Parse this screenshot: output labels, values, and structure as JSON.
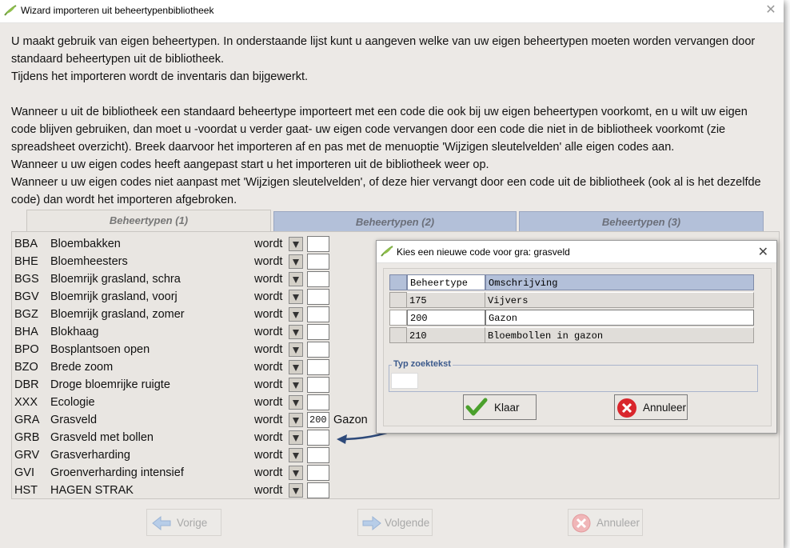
{
  "window": {
    "title": "Wizard importeren uit beheertypenbibliotheek",
    "close_glyph": "✕"
  },
  "intro": {
    "lines": [
      "U maakt gebruik van eigen beheertypen. In onderstaande lijst kunt u aangeven welke van uw eigen beheertypen moeten worden vervangen door standaard beheertypen uit de bibliotheek.",
      "Tijdens het importeren wordt de inventaris dan bijgewerkt.",
      "",
      "Wanneer u uit de bibliotheek een standaard beheertype importeert met een code die ook bij uw eigen beheertypen voorkomt, en u wilt uw eigen code blijven gebruiken, dan moet u -voordat u verder gaat- uw eigen code vervangen door een code die niet in de bibliotheek voorkomt (zie spreadsheet overzicht). Breek daarvoor het importeren af en pas met de menuoptie 'Wijzigen sleutelvelden' alle eigen codes aan.",
      "Wanneer u uw eigen codes heeft aangepast start u het importeren uit de bibliotheek weer op.",
      "Wanneer u uw eigen codes niet aanpast met 'Wijzigen sleutelvelden', of deze hier vervangt door een code uit de bibliotheek (ook al is het dezelfde code) dan wordt het importeren afgebroken."
    ]
  },
  "tabs": [
    {
      "label": "Beheertypen (1)",
      "active": true
    },
    {
      "label": "Beheertypen (2)",
      "active": false
    },
    {
      "label": "Beheertypen (3)",
      "active": false
    }
  ],
  "rows": [
    {
      "code": "BBA",
      "name": "Bloembakken",
      "wordt": "wordt",
      "value": "",
      "result": ""
    },
    {
      "code": "BHE",
      "name": "Bloemheesters",
      "wordt": "wordt",
      "value": "",
      "result": ""
    },
    {
      "code": "BGS",
      "name": "Bloemrijk grasland, schra",
      "wordt": "wordt",
      "value": "",
      "result": ""
    },
    {
      "code": "BGV",
      "name": "Bloemrijk grasland, voorj",
      "wordt": "wordt",
      "value": "",
      "result": ""
    },
    {
      "code": "BGZ",
      "name": "Bloemrijk grasland, zomer",
      "wordt": "wordt",
      "value": "",
      "result": ""
    },
    {
      "code": "BHA",
      "name": "Blokhaag",
      "wordt": "wordt",
      "value": "",
      "result": ""
    },
    {
      "code": "BPO",
      "name": "Bosplantsoen open",
      "wordt": "wordt",
      "value": "",
      "result": ""
    },
    {
      "code": "BZO",
      "name": "Brede zoom",
      "wordt": "wordt",
      "value": "",
      "result": ""
    },
    {
      "code": "DBR",
      "name": "Droge bloemrijke ruigte",
      "wordt": "wordt",
      "value": "",
      "result": ""
    },
    {
      "code": "XXX",
      "name": "Ecologie",
      "wordt": "wordt",
      "value": "",
      "result": ""
    },
    {
      "code": "GRA",
      "name": "Grasveld",
      "wordt": "wordt",
      "value": "200",
      "result": "Gazon"
    },
    {
      "code": "GRB",
      "name": "Grasveld met bollen",
      "wordt": "wordt",
      "value": "",
      "result": ""
    },
    {
      "code": "GRV",
      "name": "Grasverharding",
      "wordt": "wordt",
      "value": "",
      "result": ""
    },
    {
      "code": "GVI",
      "name": "Groenverharding intensief",
      "wordt": "wordt",
      "value": "",
      "result": ""
    },
    {
      "code": "HST",
      "name": "HAGEN STRAK",
      "wordt": "wordt",
      "value": "",
      "result": ""
    }
  ],
  "nav": {
    "prev": "Vorige",
    "next": "Volgende",
    "cancel": "Annuleer"
  },
  "dialog": {
    "title": "Kies een nieuwe code voor gra: grasveld",
    "close_glyph": "✕",
    "columns": [
      "Beheertype",
      "Omschrijving"
    ],
    "items": [
      {
        "code": "175",
        "desc": "Vijvers",
        "selected": false
      },
      {
        "code": "200",
        "desc": "Gazon",
        "selected": true
      },
      {
        "code": "210",
        "desc": "Bloembollen in gazon",
        "selected": false
      }
    ],
    "search_label": "Typ zoektekst",
    "search_value": "",
    "ok": "Klaar",
    "cancel": "Annuleer"
  },
  "colors": {
    "accent": "#b3c0d9",
    "arrow": "#2e4a7a",
    "ok_green": "#4aa02c",
    "cancel_red": "#d9262c"
  }
}
